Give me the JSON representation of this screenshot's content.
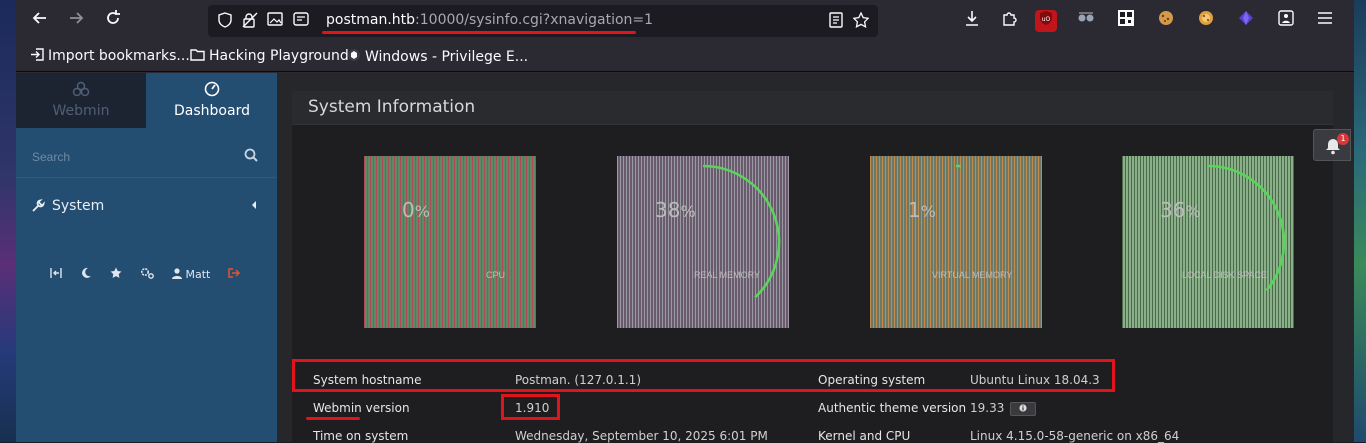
{
  "browser": {
    "url_host": "postman.htb",
    "url_rest": ":10000/sysinfo.cgi?xnavigation=1",
    "bookmarks": [
      {
        "label": "Import bookmarks...",
        "icon": "import-icon"
      },
      {
        "label": "Hacking Playground",
        "icon": "folder-icon"
      },
      {
        "label": "Windows - Privilege E...",
        "icon": "site-icon"
      }
    ],
    "annotation_color": "#e0141a"
  },
  "sidebar": {
    "tabs": [
      {
        "label": "Webmin",
        "icon": "webmin-logo-icon"
      },
      {
        "label": "Dashboard",
        "icon": "dashboard-gauge-icon"
      }
    ],
    "search_placeholder": "Search",
    "menu": [
      {
        "label": "System",
        "icon": "wrench-icon"
      }
    ],
    "footer": {
      "user": "Matt"
    },
    "background": "#244d72"
  },
  "panel": {
    "title": "System Information"
  },
  "gauges": [
    {
      "label": "CPU",
      "percent": 0
    },
    {
      "label": "REAL MEMORY",
      "percent": 38
    },
    {
      "label": "VIRTUAL MEMORY",
      "percent": 1
    },
    {
      "label": "LOCAL DISK SPACE",
      "percent": 36
    }
  ],
  "info": {
    "hostname_label": "System hostname",
    "hostname_value": "Postman. (127.0.1.1)",
    "os_label": "Operating system",
    "os_value": "Ubuntu Linux 18.04.3",
    "webmin_label": "Webmin version",
    "webmin_value": "1.910",
    "theme_label": "Authentic theme version",
    "theme_value": "19.33",
    "time_label": "Time on system",
    "time_value": "Wednesday, September 10, 2025 6:01 PM",
    "kernel_label": "Kernel and CPU",
    "kernel_value": "Linux 4.15.0-58-generic on x86_64"
  },
  "notifications": {
    "count": "1"
  }
}
